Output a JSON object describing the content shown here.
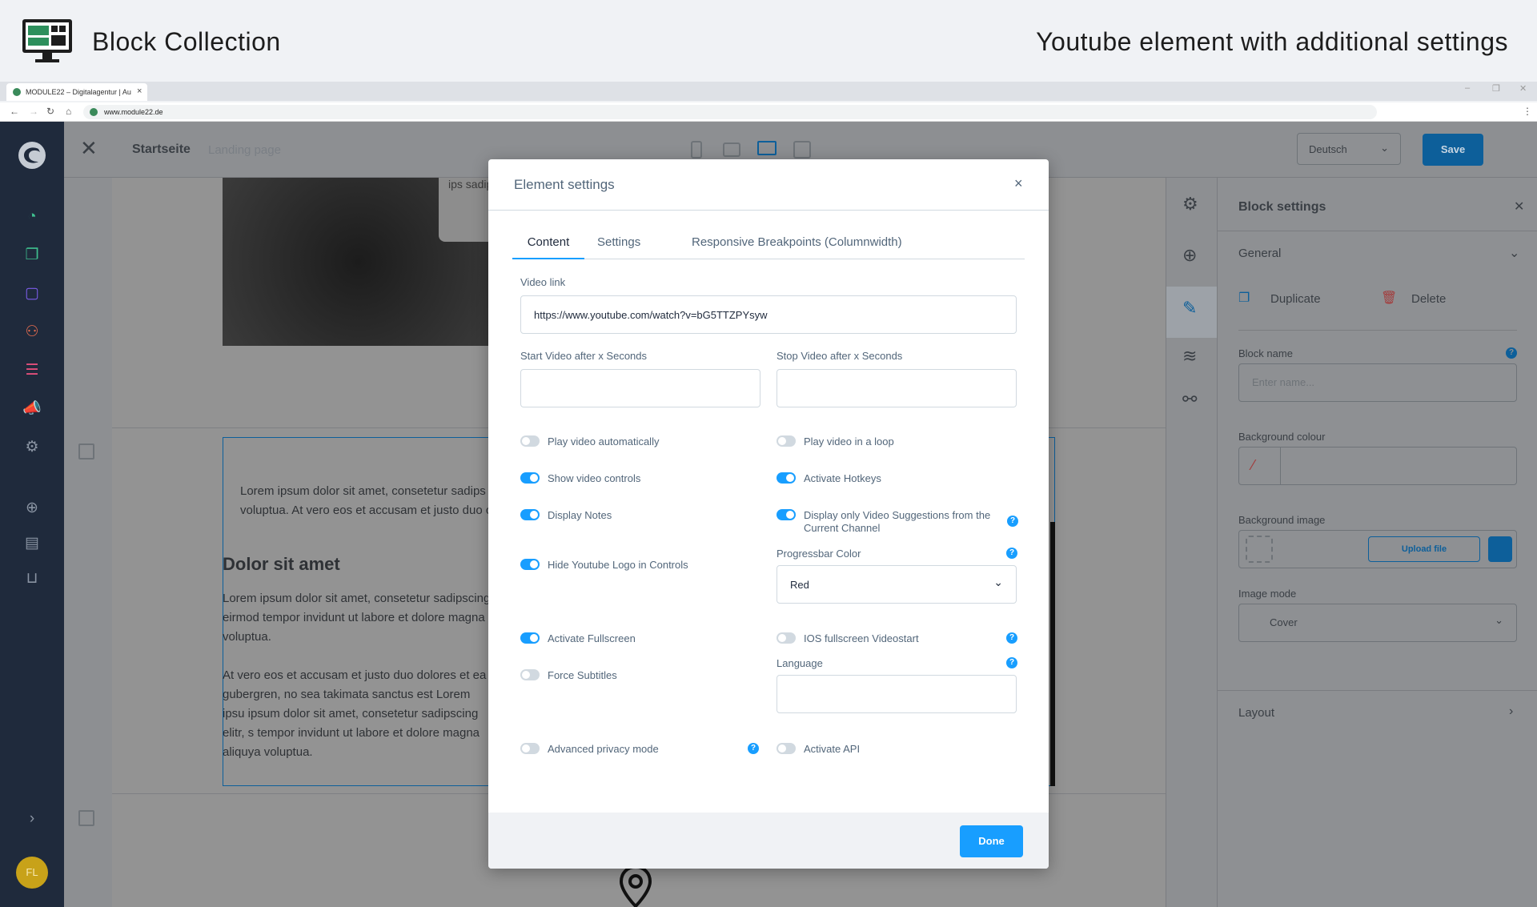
{
  "banner": {
    "title": "Block Collection",
    "subtitle": "Youtube element with additional settings"
  },
  "browser": {
    "tab_title": "MODULE22 – Digitalagentur | Au",
    "tab_close": "×",
    "url": "www.module22.de",
    "min": "–",
    "restore": "❐",
    "close": "✕",
    "menu": "⋮"
  },
  "topbar": {
    "page_name": "Startseite",
    "page_type": "Landing page",
    "language": "Deutsch",
    "save_label": "Save"
  },
  "sidebar": {
    "user_initials": "FL"
  },
  "stage": {
    "text_top": "ips sadipsc",
    "p1": "Lorem ipsum dolor sit amet, consetetur sadips voluptua. At vero eos et accusam et justo duo c",
    "heading": "Dolor sit amet",
    "p2": "Lorem ipsum dolor sit amet, consetetur sadipscing eirmod tempor invidunt ut labore et dolore magna voluptua.",
    "p3": "At vero eos et accusam et justo duo dolores et ea r gubergren, no sea takimata sanctus est Lorem ipsu ipsum dolor sit amet, consetetur sadipscing elitr, s tempor invidunt ut labore et dolore magna aliquya voluptua."
  },
  "block_settings": {
    "title": "Block settings",
    "general": "General",
    "duplicate": "Duplicate",
    "delete": "Delete",
    "block_name_label": "Block name",
    "block_name_placeholder": "Enter name...",
    "bg_colour_label": "Background colour",
    "bg_image_label": "Background image",
    "upload_label": "Upload file",
    "image_mode_label": "Image mode",
    "image_mode_value": "Cover",
    "layout": "Layout"
  },
  "modal": {
    "title": "Element settings",
    "tabs": [
      "Content",
      "Settings",
      "Responsive Breakpoints (Columnwidth)"
    ],
    "video_link_label": "Video link",
    "video_link_value": "https://www.youtube.com/watch?v=bG5TTZPYsyw",
    "start_label": "Start Video after x Seconds",
    "stop_label": "Stop Video after x Seconds",
    "toggles": {
      "autoplay": {
        "label": "Play video automatically",
        "on": false
      },
      "loop": {
        "label": "Play video in a loop",
        "on": false
      },
      "controls": {
        "label": "Show video controls",
        "on": true
      },
      "hotkeys": {
        "label": "Activate Hotkeys",
        "on": true
      },
      "notes": {
        "label": "Display Notes",
        "on": true
      },
      "suggestions": {
        "label": "Display only Video Suggestions from the Current Channel",
        "on": true
      },
      "hide_logo": {
        "label": "Hide Youtube Logo in Controls",
        "on": true
      },
      "fullscreen": {
        "label": "Activate Fullscreen",
        "on": true
      },
      "ios_fullscreen": {
        "label": "IOS fullscreen Videostart",
        "on": false
      },
      "subtitles": {
        "label": "Force Subtitles",
        "on": false
      },
      "privacy": {
        "label": "Advanced privacy mode",
        "on": false
      },
      "api": {
        "label": "Activate API",
        "on": false
      }
    },
    "progressbar_label": "Progressbar Color",
    "progressbar_value": "Red",
    "language_label": "Language",
    "done_label": "Done",
    "close": "×"
  }
}
